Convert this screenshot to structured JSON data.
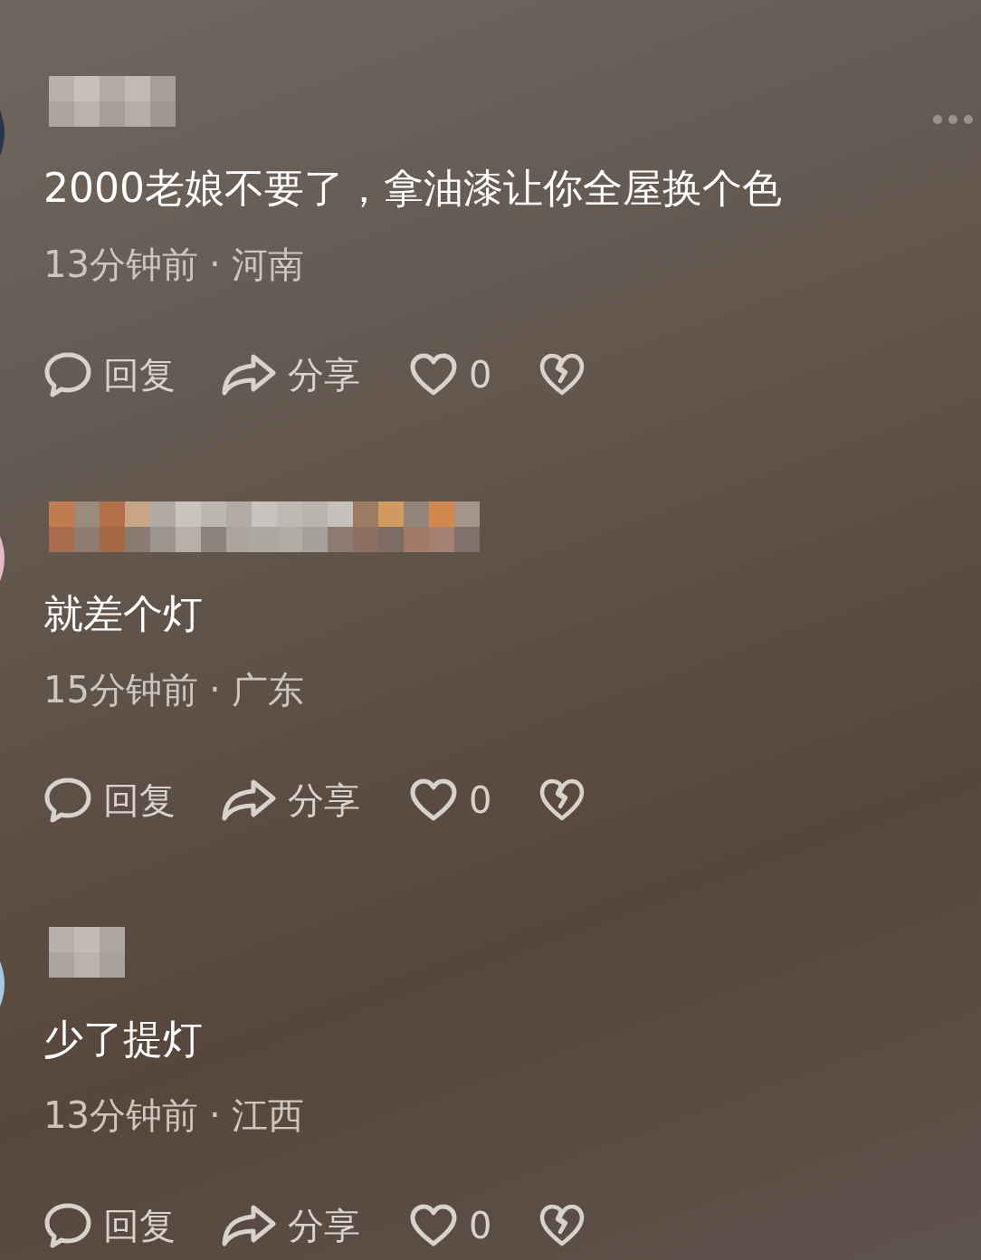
{
  "comments": [
    {
      "text": "2000老娘不要了，拿油漆让你全屋换个色",
      "time": "13分钟前",
      "separator": "·",
      "location": "河南",
      "reply": "回复",
      "share": "分享",
      "likes": "0"
    },
    {
      "text": "就差个灯",
      "time": "15分钟前",
      "separator": "·",
      "location": "广东",
      "reply": "回复",
      "share": "分享",
      "likes": "0"
    },
    {
      "text": "少了提灯",
      "time": "13分钟前",
      "separator": "·",
      "location": "江西",
      "reply": "回复",
      "share": "分享",
      "likes": "0"
    }
  ]
}
